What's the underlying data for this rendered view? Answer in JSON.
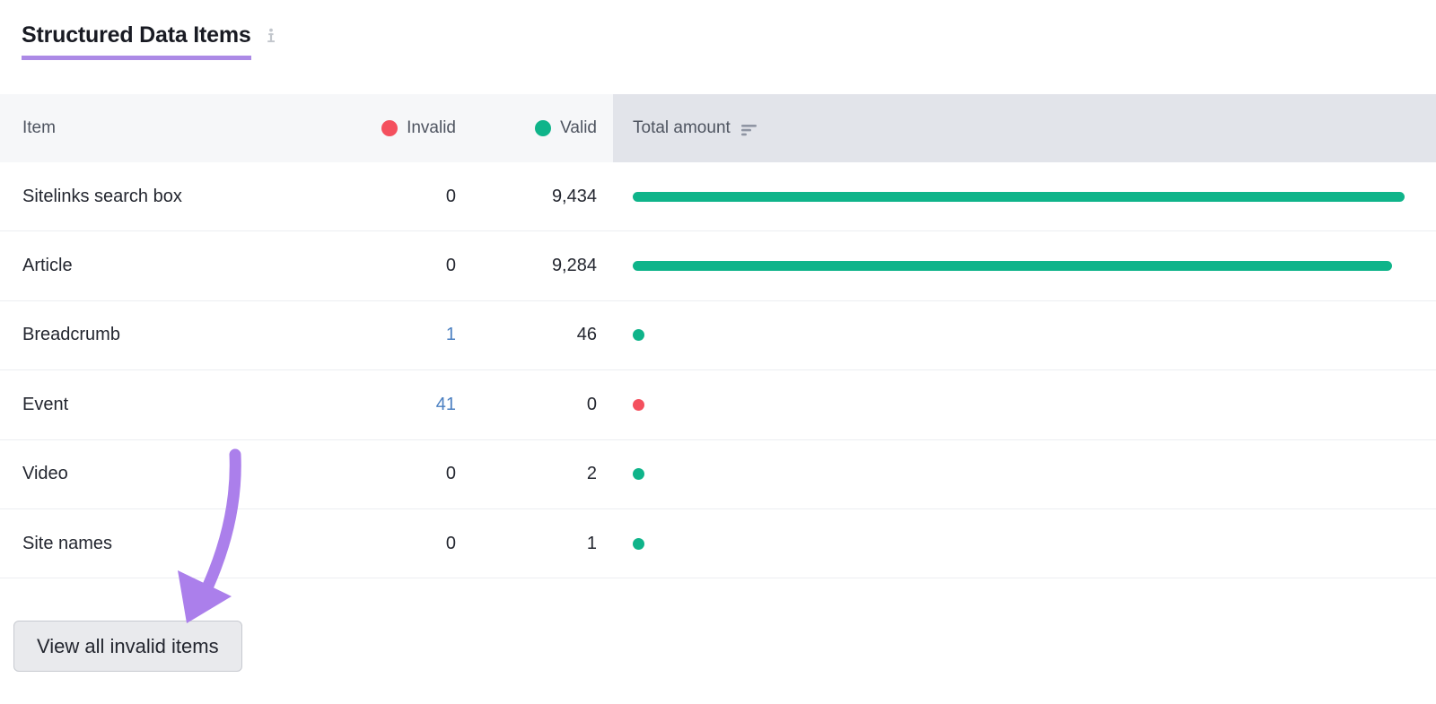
{
  "header": {
    "title": "Structured Data Items",
    "info_icon": "info-icon"
  },
  "table": {
    "columns": {
      "item": "Item",
      "invalid": "Invalid",
      "valid": "Valid",
      "total_amount": "Total amount",
      "sort_icon": "sort-descending-icon"
    },
    "rows": [
      {
        "item": "Sitelinks search box",
        "invalid": "0",
        "valid": "9,434",
        "invalid_is_link": false,
        "bar_pct": 100.0,
        "bar_kind": "bar",
        "bar_color": "valid"
      },
      {
        "item": "Article",
        "invalid": "0",
        "valid": "9,284",
        "invalid_is_link": false,
        "bar_pct": 98.4,
        "bar_kind": "bar",
        "bar_color": "valid"
      },
      {
        "item": "Breadcrumb",
        "invalid": "1",
        "valid": "46",
        "invalid_is_link": true,
        "bar_pct": 0.5,
        "bar_kind": "dot",
        "bar_color": "valid"
      },
      {
        "item": "Event",
        "invalid": "41",
        "valid": "0",
        "invalid_is_link": true,
        "bar_pct": 0.5,
        "bar_kind": "dot",
        "bar_color": "invalid"
      },
      {
        "item": "Video",
        "invalid": "0",
        "valid": "2",
        "invalid_is_link": false,
        "bar_pct": 0.5,
        "bar_kind": "dot",
        "bar_color": "valid"
      },
      {
        "item": "Site names",
        "invalid": "0",
        "valid": "1",
        "invalid_is_link": false,
        "bar_pct": 0.5,
        "bar_kind": "dot",
        "bar_color": "valid"
      }
    ]
  },
  "footer": {
    "view_all_label": "View all invalid items"
  },
  "annotation": {
    "arrow": "curved-arrow-annotation"
  },
  "colors": {
    "accent_purple": "#ac8ae6",
    "invalid_red": "#f4505e",
    "valid_green": "#0fb48a",
    "link_blue": "#4a7fc1",
    "header_bg": "#f6f7f9",
    "header_amount_bg": "#e2e4ea",
    "row_border": "#eceef1",
    "button_bg": "#e9eaed"
  },
  "chart_data": {
    "type": "bar",
    "title": "Structured Data Items",
    "orientation": "horizontal",
    "categories": [
      "Sitelinks search box",
      "Article",
      "Breadcrumb",
      "Event",
      "Video",
      "Site names"
    ],
    "series": [
      {
        "name": "Invalid",
        "values": [
          0,
          0,
          1,
          41,
          0,
          0
        ],
        "color": "#f4505e"
      },
      {
        "name": "Valid",
        "values": [
          9434,
          9284,
          46,
          0,
          2,
          1
        ],
        "color": "#0fb48a"
      }
    ],
    "total_amount": [
      9434,
      9284,
      47,
      41,
      2,
      1
    ],
    "xlabel": "Total amount",
    "ylabel": "Item",
    "legend": [
      "Invalid",
      "Valid"
    ],
    "legend_position": "header",
    "grid": false,
    "xlim": [
      0,
      9434
    ]
  }
}
